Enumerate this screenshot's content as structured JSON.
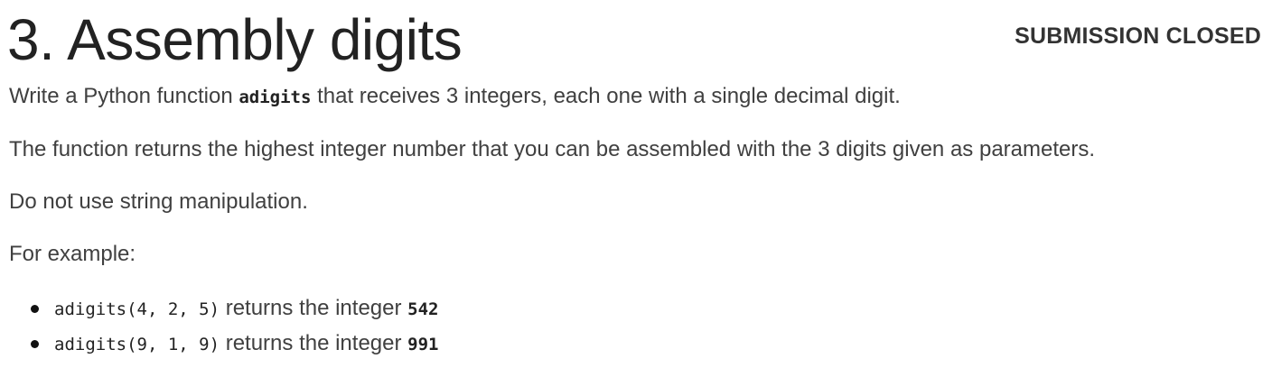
{
  "header": {
    "title": "3. Assembly digits",
    "status": "SUBMISSION CLOSED"
  },
  "content": {
    "p1_pre": "Write a Python function ",
    "p1_code": "adigits",
    "p1_post": " that receives 3 integers, each one with a single decimal digit.",
    "p2": "The function returns the highest integer number that you can be assembled with the 3 digits given as parameters.",
    "p3": "Do not use string manipulation.",
    "p4": "For example:",
    "examples": [
      {
        "call": "adigits(4, 2, 5)",
        "text": " returns the integer ",
        "result": "542"
      },
      {
        "call": "adigits(9, 1, 9)",
        "text": " returns the integer ",
        "result": "991"
      }
    ]
  }
}
